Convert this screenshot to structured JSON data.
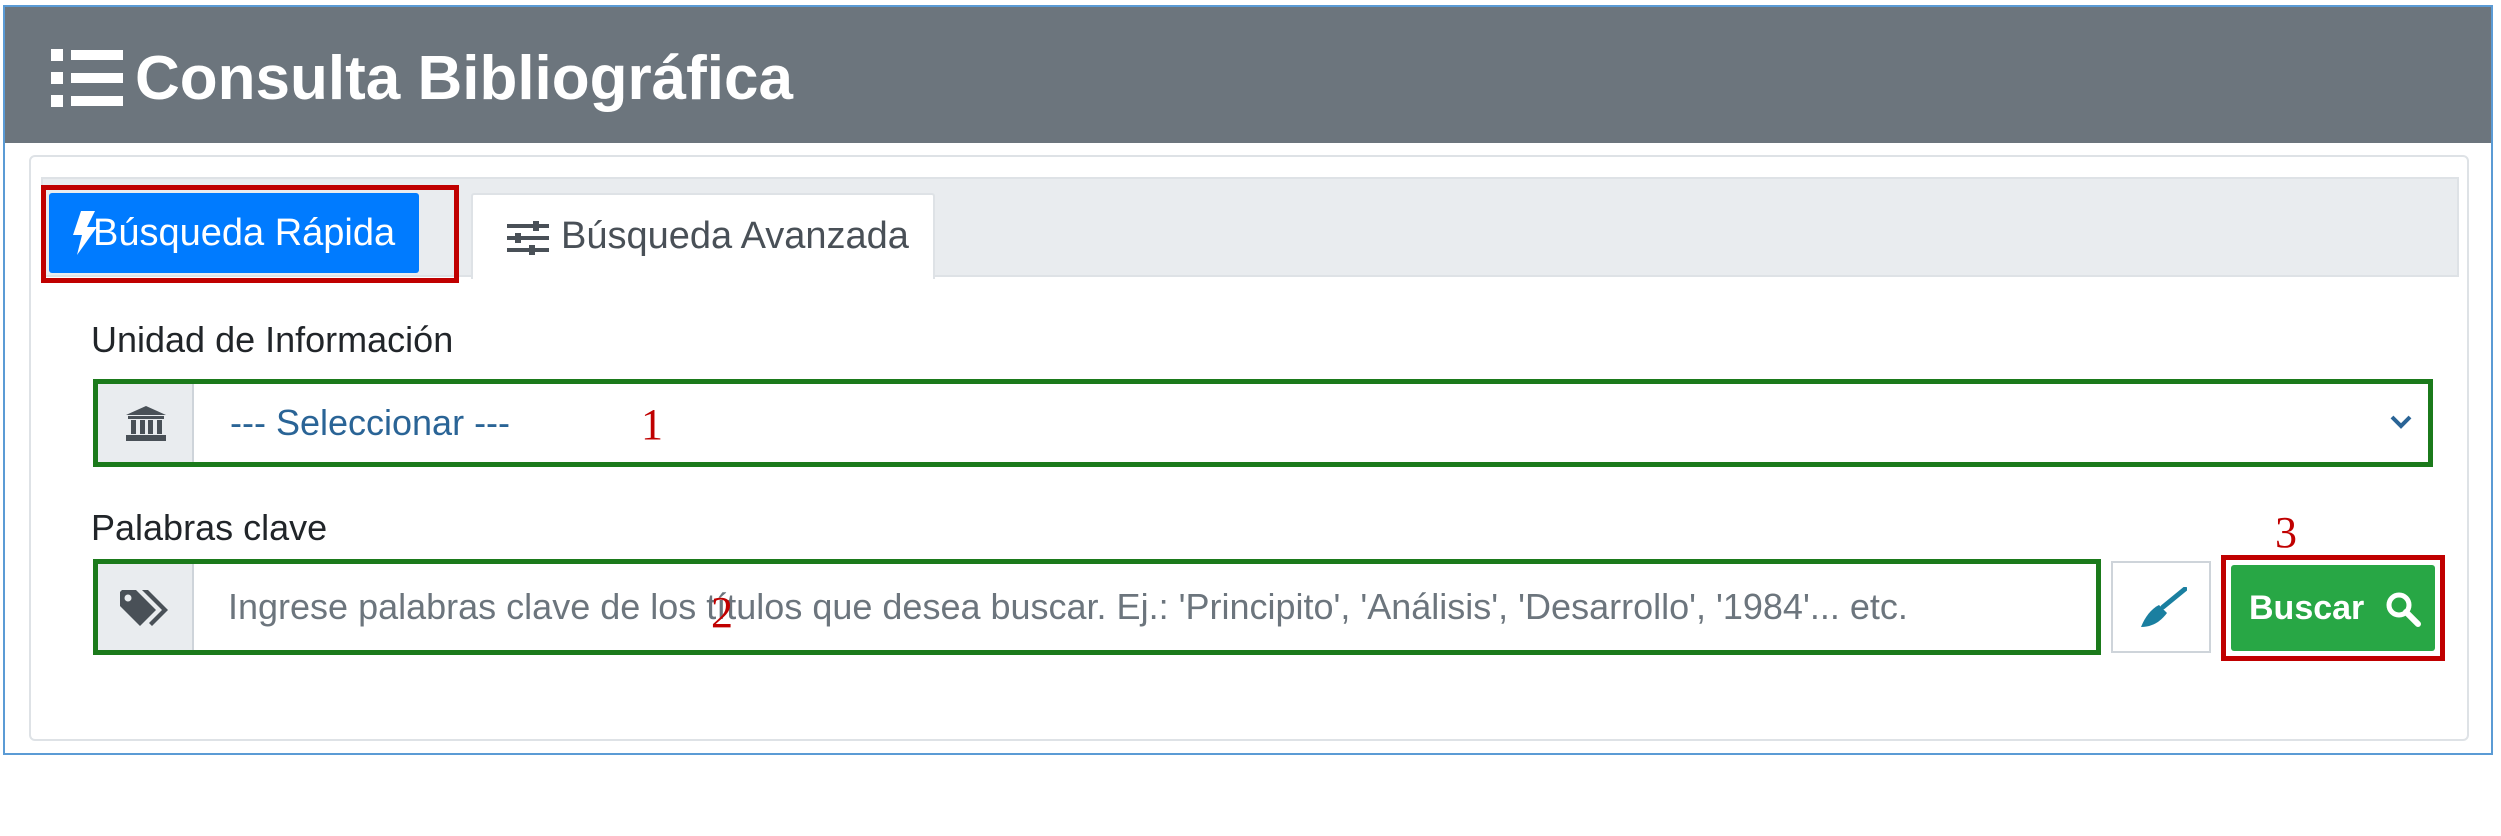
{
  "header": {
    "title": "Consulta Bibliográfica",
    "icon": "list-icon"
  },
  "tabs": [
    {
      "label": "Búsqueda Rápida",
      "icon": "bolt-icon",
      "active": true
    },
    {
      "label": "Búsqueda Avanzada",
      "icon": "sliders-icon",
      "active": false
    }
  ],
  "unidad": {
    "label": "Unidad de Información",
    "icon": "building-icon",
    "selected": "--- Seleccionar ---"
  },
  "keywords": {
    "label": "Palabras clave",
    "icon": "tags-icon",
    "value": "",
    "placeholder": "Ingrese palabras clave de los títulos que desea buscar. Ej.: 'Principito', 'Análisis', 'Desarrollo', '1984'... etc."
  },
  "actions": {
    "clear_icon": "broom-icon",
    "search_label": "Buscar",
    "search_icon": "search-icon"
  },
  "markers": [
    "1",
    "2",
    "3"
  ],
  "colors": {
    "header_bg": "#6c757d",
    "primary": "#007bff",
    "success": "#28a745",
    "annotation_red": "#c00000",
    "annotation_green": "#1b7a1b"
  }
}
